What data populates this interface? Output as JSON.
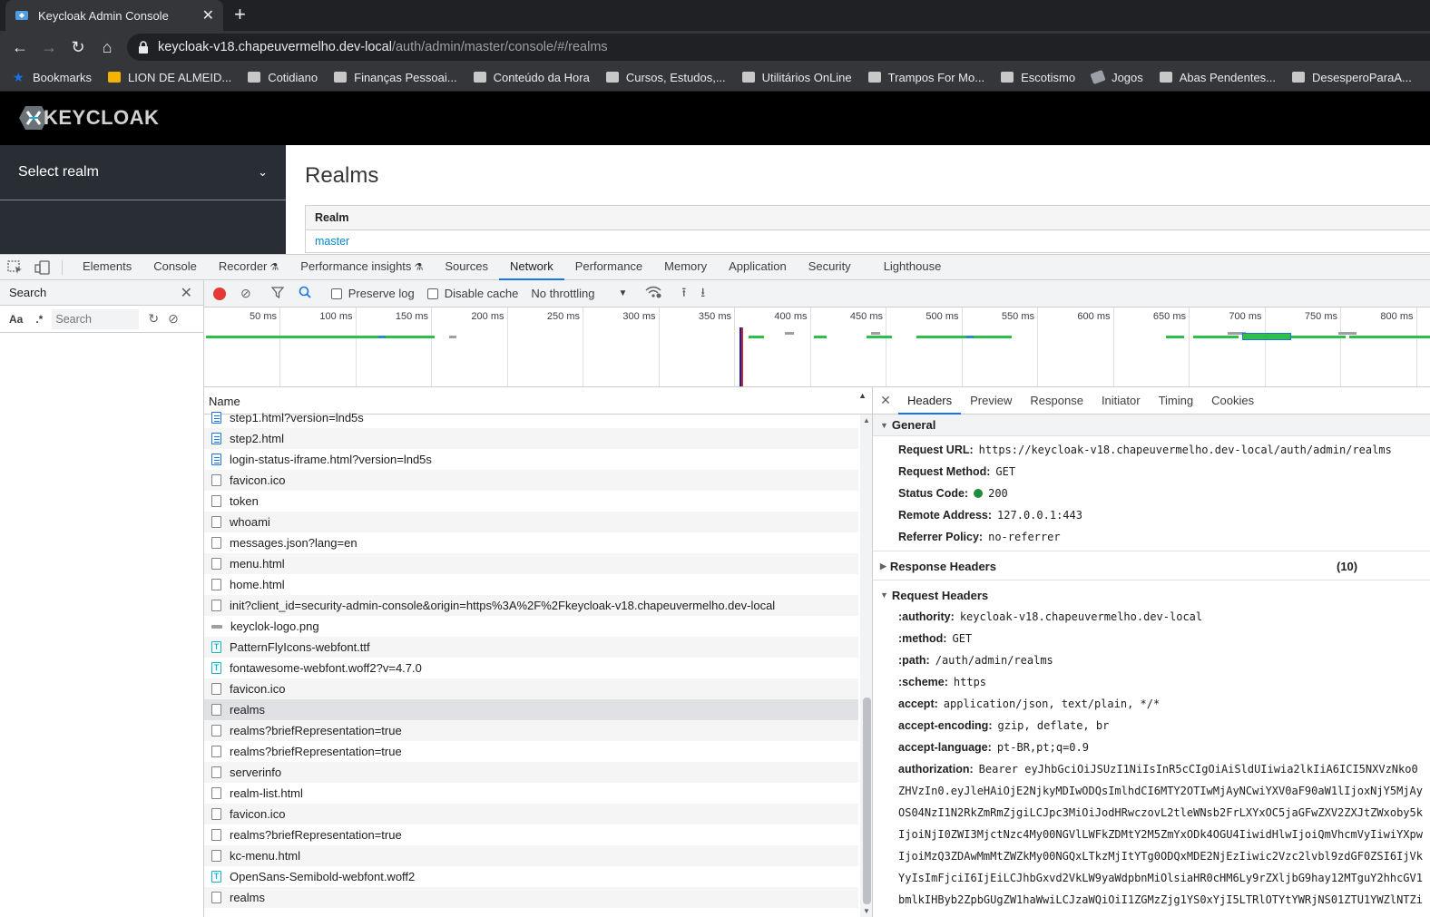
{
  "browser": {
    "tab_title": "Keycloak Admin Console",
    "url_host": "keycloak-v18.chapeuvermelho.dev-local",
    "url_path": "/auth/admin/master/console/#/realms",
    "bookmarks": [
      {
        "label": "Bookmarks",
        "icon": "star-icon"
      },
      {
        "label": "LION DE ALMEID...",
        "icon": "bookmark-favicon"
      },
      {
        "label": "Cotidiano",
        "icon": "folder-icon"
      },
      {
        "label": "Finanças Pessoai...",
        "icon": "folder-icon"
      },
      {
        "label": "Conteúdo da Hora",
        "icon": "folder-icon"
      },
      {
        "label": "Cursos, Estudos,...",
        "icon": "folder-icon"
      },
      {
        "label": "Utilitários OnLine",
        "icon": "folder-icon"
      },
      {
        "label": "Trampos For Mo...",
        "icon": "folder-icon"
      },
      {
        "label": "Escotismo",
        "icon": "folder-icon"
      },
      {
        "label": "Jogos",
        "icon": "game-icon"
      },
      {
        "label": "Abas Pendentes...",
        "icon": "folder-icon"
      },
      {
        "label": "DesesperoParaA...",
        "icon": "folder-icon"
      }
    ]
  },
  "keycloak": {
    "logo_text": "KEYCLOAK",
    "realm_selector": "Select realm",
    "page_title": "Realms",
    "table_header": "Realm",
    "table_rows": [
      "master"
    ]
  },
  "devtools": {
    "tabs": [
      "Elements",
      "Console",
      "Recorder",
      "Performance insights",
      "Sources",
      "Network",
      "Performance",
      "Memory",
      "Application",
      "Security",
      "Lighthouse"
    ],
    "active_tab": "Network",
    "search": {
      "title": "Search",
      "aa": "Aa",
      "regex": ".*",
      "placeholder": "Search"
    },
    "network_toolbar": {
      "preserve_log": "Preserve log",
      "disable_cache": "Disable cache",
      "throttling": "No throttling"
    },
    "timeline_ticks": [
      "50 ms",
      "100 ms",
      "150 ms",
      "200 ms",
      "250 ms",
      "300 ms",
      "350 ms",
      "400 ms",
      "450 ms",
      "500 ms",
      "550 ms",
      "600 ms",
      "650 ms",
      "700 ms",
      "750 ms",
      "800 ms"
    ],
    "name_header": "Name",
    "requests": [
      {
        "name": "step1.html?version=lnd5s",
        "type": "doc"
      },
      {
        "name": "step2.html",
        "type": "doc"
      },
      {
        "name": "login-status-iframe.html?version=lnd5s",
        "type": "doc"
      },
      {
        "name": "favicon.ico",
        "type": "other"
      },
      {
        "name": "token",
        "type": "other"
      },
      {
        "name": "whoami",
        "type": "other"
      },
      {
        "name": "messages.json?lang=en",
        "type": "other"
      },
      {
        "name": "menu.html",
        "type": "other"
      },
      {
        "name": "home.html",
        "type": "other"
      },
      {
        "name": "init?client_id=security-admin-console&origin=https%3A%2F%2Fkeycloak-v18.chapeuvermelho.dev-local",
        "type": "other"
      },
      {
        "name": "keyclok-logo.png",
        "type": "img"
      },
      {
        "name": "PatternFlyIcons-webfont.ttf",
        "type": "font"
      },
      {
        "name": "fontawesome-webfont.woff2?v=4.7.0",
        "type": "font"
      },
      {
        "name": "favicon.ico",
        "type": "other"
      },
      {
        "name": "realms",
        "type": "other",
        "selected": true
      },
      {
        "name": "realms?briefRepresentation=true",
        "type": "other"
      },
      {
        "name": "realms?briefRepresentation=true",
        "type": "other"
      },
      {
        "name": "serverinfo",
        "type": "other"
      },
      {
        "name": "realm-list.html",
        "type": "other"
      },
      {
        "name": "favicon.ico",
        "type": "other"
      },
      {
        "name": "realms?briefRepresentation=true",
        "type": "other"
      },
      {
        "name": "kc-menu.html",
        "type": "other"
      },
      {
        "name": "OpenSans-Semibold-webfont.woff2",
        "type": "font"
      },
      {
        "name": "realms",
        "type": "other"
      }
    ],
    "detail_tabs": [
      "Headers",
      "Preview",
      "Response",
      "Initiator",
      "Timing",
      "Cookies"
    ],
    "general": {
      "title": "General",
      "rows": [
        {
          "k": "Request URL:",
          "v": "https://keycloak-v18.chapeuvermelho.dev-local/auth/admin/realms"
        },
        {
          "k": "Request Method:",
          "v": "GET"
        },
        {
          "k": "Status Code:",
          "v": "200",
          "status": true
        },
        {
          "k": "Remote Address:",
          "v": "127.0.0.1:443"
        },
        {
          "k": "Referrer Policy:",
          "v": "no-referrer"
        }
      ]
    },
    "response_headers": {
      "title": "Response Headers",
      "count": "(10)"
    },
    "request_headers": {
      "title": "Request Headers",
      "rows": [
        {
          "k": ":authority:",
          "v": "keycloak-v18.chapeuvermelho.dev-local"
        },
        {
          "k": ":method:",
          "v": "GET"
        },
        {
          "k": ":path:",
          "v": "/auth/admin/realms"
        },
        {
          "k": ":scheme:",
          "v": "https"
        },
        {
          "k": "accept:",
          "v": "application/json, text/plain, */*"
        },
        {
          "k": "accept-encoding:",
          "v": "gzip, deflate, br"
        },
        {
          "k": "accept-language:",
          "v": "pt-BR,pt;q=0.9"
        },
        {
          "k": "authorization:",
          "v": "Bearer eyJhbGciOiJSUzI1NiIsInR5cCIgOiAiSldUIiwia2lkIiA6ICI5NXVzNko0"
        }
      ],
      "authorization_cont": [
        "ZHVzIn0.eyJleHAiOjE2NjkyMDIwODQsImlhdCI6MTY2OTIwMjAyNCwiYXV0aF90aW1lIjoxNjY5MjAy",
        "OS04NzI1N2RkZmRmZjgiLCJpc3MiOiJodHRwczovL2tleWNsb2FrLXYxOC5jaGFwZXV2ZXJtZWxoby5k",
        "IjoiNjI0ZWI3MjctNzc4My00NGVlLWFkZDMtY2M5ZmYxODk4OGU4IiwidHlwIjoiQmVhcmVyIiwiYXpw",
        "IjoiMzQ3ZDAwMmMtZWZkMy00NGQxLTkzMjItYTg0ODQxMDE2NjEzIiwic2Vzc2lvbl9zdGF0ZSI6IjVk",
        "YyIsImFjciI6IjEiLCJhbGxvd2VkLW9yaWdpbnMiOlsiaHR0cHM6Ly9rZXljbG9hay12MTguY2hhcGV1",
        "bmlkIHByb2ZpbGUgZW1haWwiLCJzaWQiOiI1ZGMzZjg1YS0xYjI5LTRlOTYtYWRjNS01ZTU1YWZlNTZi"
      ]
    }
  }
}
